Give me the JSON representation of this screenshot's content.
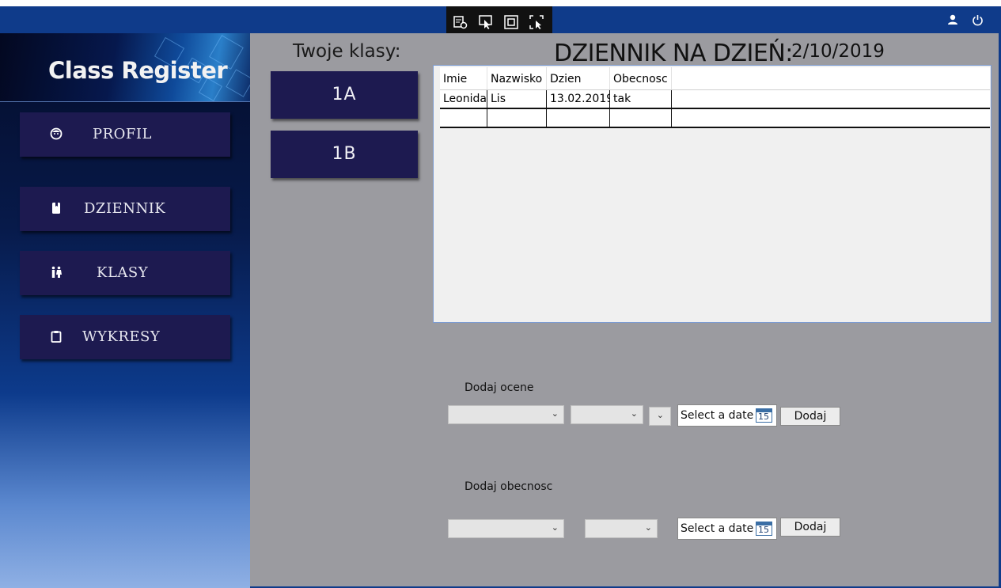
{
  "app": {
    "title": "Class Register",
    "titlebar_icons": [
      "user-icon",
      "power-icon"
    ],
    "overlay_toolbar_icons": [
      "screen-settings-icon",
      "select-pointer-icon",
      "window-capture-icon",
      "region-capture-icon"
    ]
  },
  "sidebar": {
    "items": [
      {
        "label": "PROFIL",
        "icon": "face-icon"
      },
      {
        "label": "DZIENNIK",
        "icon": "book-icon"
      },
      {
        "label": "KLASY",
        "icon": "people-icon"
      },
      {
        "label": "WYKRESY",
        "icon": "clipboard-icon"
      }
    ]
  },
  "classes": {
    "title": "Twoje klasy:",
    "items": [
      "1A",
      "1B"
    ]
  },
  "journal": {
    "title": "DZIENNIK NA DZIEŃ:",
    "date": "2/10/2019",
    "columns": [
      "Imie",
      "Nazwisko",
      "Dzien",
      "Obecnosc"
    ],
    "rows": [
      [
        "Leonida",
        "Lis",
        "13.02.2019",
        "tak"
      ],
      [
        "",
        "",
        "",
        ""
      ]
    ]
  },
  "add_grade": {
    "label": "Dodaj ocene",
    "date_placeholder": "Select a date",
    "calendar_day": "15",
    "button_label": "Dodaj"
  },
  "add_attendance": {
    "label": "Dodaj obecnosc",
    "date_placeholder": "Select a date",
    "calendar_day": "15",
    "button_label": "Dodaj"
  },
  "colors": {
    "titlebar": "#0f3b8a",
    "nav_button": "#1d1a50",
    "main_bg": "#9b9ba0"
  }
}
